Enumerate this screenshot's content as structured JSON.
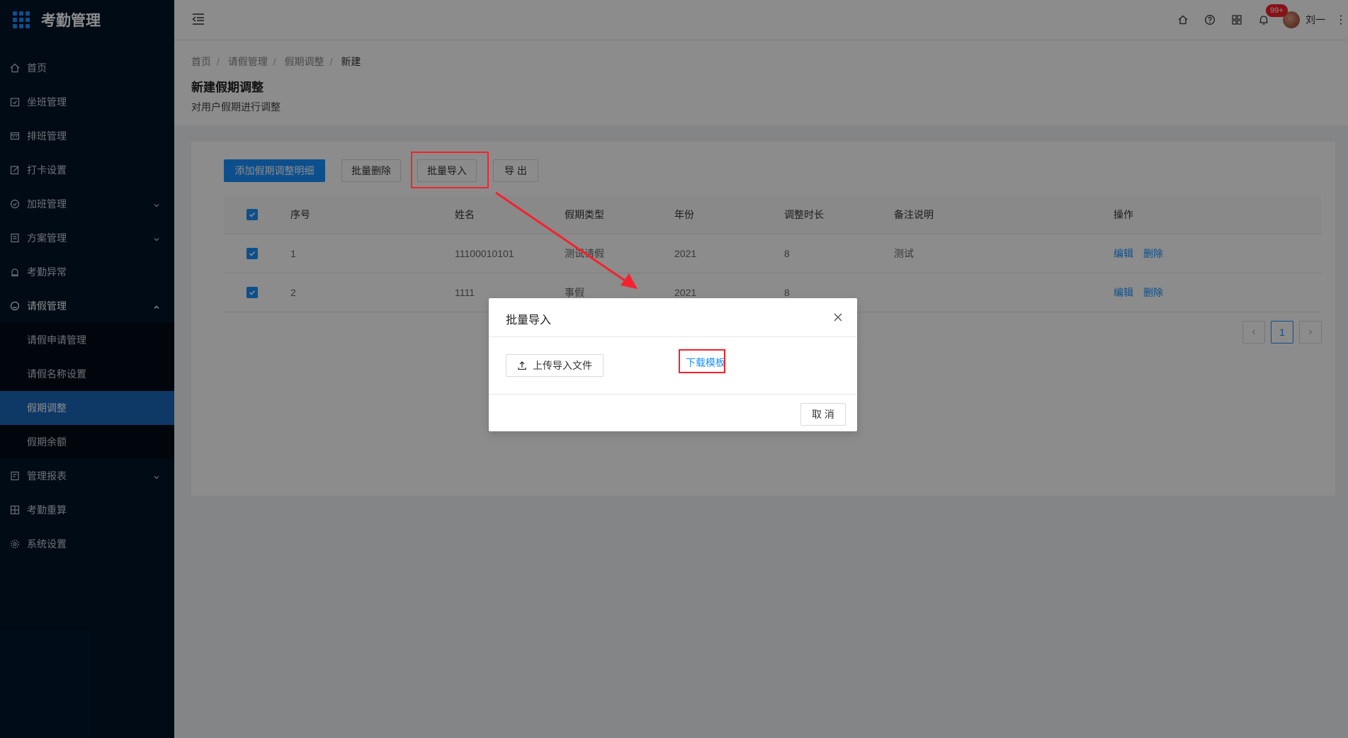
{
  "app": {
    "title": "考勤管理"
  },
  "sidebar": {
    "items": [
      {
        "label": "首页",
        "icon": "home-icon"
      },
      {
        "label": "坐班管理",
        "icon": "calendar-check-icon"
      },
      {
        "label": "排班管理",
        "icon": "schedule-icon"
      },
      {
        "label": "打卡设置",
        "icon": "edit-icon"
      },
      {
        "label": "加班管理",
        "icon": "clock-icon",
        "expandable": true
      },
      {
        "label": "方案管理",
        "icon": "document-icon",
        "expandable": true
      },
      {
        "label": "考勤异常",
        "icon": "alarm-icon"
      },
      {
        "label": "请假管理",
        "icon": "smile-icon",
        "expandable": true,
        "open": true
      }
    ],
    "subitems": [
      {
        "label": "请假申请管理"
      },
      {
        "label": "请假名称设置"
      },
      {
        "label": "假期调整",
        "active": true
      },
      {
        "label": "假期余额"
      }
    ],
    "items_after": [
      {
        "label": "管理报表",
        "icon": "report-icon",
        "expandable": true
      },
      {
        "label": "考勤重算",
        "icon": "calculator-icon"
      },
      {
        "label": "系统设置",
        "icon": "gear-icon"
      }
    ]
  },
  "header": {
    "notification_badge": "99+",
    "username": "刘一"
  },
  "breadcrumb": [
    "首页",
    "请假管理",
    "假期调整",
    "新建"
  ],
  "page": {
    "title": "新建假期调整",
    "description": "对用户假期进行调整"
  },
  "toolbar": {
    "add_label": "添加假期调整明细",
    "batch_delete_label": "批量删除",
    "batch_import_label": "批量导入",
    "export_label": "导 出"
  },
  "table": {
    "columns": [
      "序号",
      "姓名",
      "假期类型",
      "年份",
      "调整时长",
      "备注说明",
      "操作"
    ],
    "rows": [
      {
        "index": "1",
        "name": "11100010101",
        "type": "测试请假",
        "year": "2021",
        "duration": "8",
        "remark": "测试",
        "edit": "编辑",
        "delete": "删除"
      },
      {
        "index": "2",
        "name": "1111",
        "type": "事假",
        "year": "2021",
        "duration": "8",
        "remark": "",
        "edit": "编辑",
        "delete": "删除"
      }
    ]
  },
  "pagination": {
    "current": "1"
  },
  "modal": {
    "title": "批量导入",
    "upload_label": "上传导入文件",
    "download_label": "下载模板",
    "cancel_label": "取 消"
  },
  "colors": {
    "primary": "#1890ff",
    "sidebar": "#001529",
    "highlight": "#f5222d"
  }
}
